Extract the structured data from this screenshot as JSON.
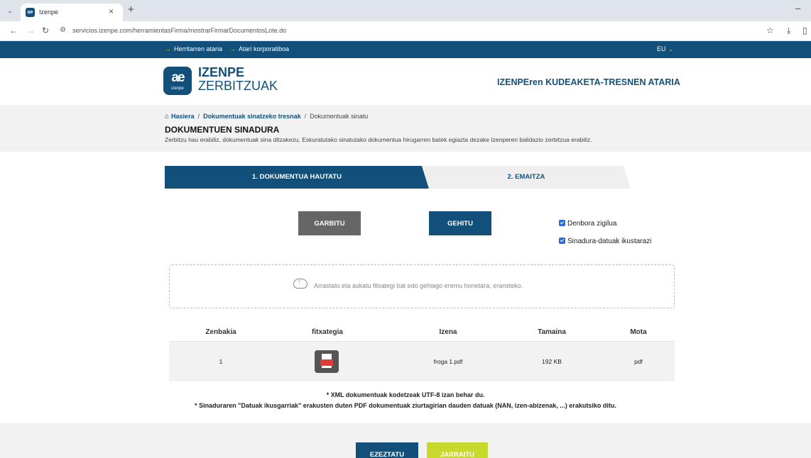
{
  "browser": {
    "tab_title": "Izenpe",
    "favicon_text": "ae",
    "url": "servicios.izenpe.com/herramientasFirma/mostrarFirmarDocumentosLote.do"
  },
  "topnav": {
    "links": [
      "Herritarren ataria",
      "Atari korporatiboa"
    ],
    "language": "EU"
  },
  "header": {
    "logo_mark": "ae",
    "logo_mark_sub": "izenpe",
    "logo_title": "IZENPE",
    "logo_subtitle": "ZERBITZUAK",
    "portal_title": "IZENPEren KUDEAKETA-TRESNEN ATARIA"
  },
  "breadcrumb": {
    "home": "Hasiera",
    "parent": "Dokumentuak sinatzeko tresnak",
    "current": "Dokumentuak sinatu"
  },
  "page": {
    "title": "DOKUMENTUEN SINADURA",
    "description": "Zerbitzu hau erabiliz, dokumentuak sina ditzakezu. Eskuratutako sinatutako dokumentua hirugarren batek egiazta dezake Izenperen balidazio zerbitzua erabiliz."
  },
  "steps": {
    "step1": "1. DOKUMENTUA HAUTATU",
    "step2": "2. EMAITZA"
  },
  "actions": {
    "clear": "GARBITU",
    "add": "GEHITU"
  },
  "options": {
    "timestamp": "Denbora zigilua",
    "show_signature_data": "Sinadura-datuak ikustarazi"
  },
  "dropzone": {
    "text": "Arrastatu eta askatu fitxategi bat edo gehiago eremu honetara, eransteko."
  },
  "table": {
    "columns": [
      "Zenbakia",
      "fitxategia",
      "Izena",
      "Tamaina",
      "Mota"
    ],
    "rows": [
      {
        "number": "1",
        "name": "froga 1.pdf",
        "size": "192 KB",
        "type": "pdf"
      }
    ]
  },
  "notes": {
    "line1": "* XML dokumentuak kodetzeak UTF-8 izan behar du.",
    "line2": "* Sinaduraren \"Datuak ikusgarriak\" erakusten duten PDF dokumentuak ziurtagirian dauden datuak (NAN, izen-abizenak, ...) erakutsiko ditu."
  },
  "footer": {
    "cancel": "EZEZTATU",
    "continue": "JARRAITU"
  },
  "colors": {
    "brand_blue": "#12507b",
    "accent_green": "#c6d92c",
    "button_gray": "#666666"
  }
}
